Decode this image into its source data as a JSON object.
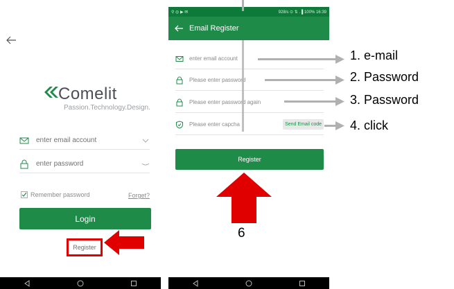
{
  "login_screen": {
    "brand": "Comelit",
    "tagline": "Passion.Technology.Design.",
    "email_placeholder": "enter email account",
    "password_placeholder": "enter password",
    "remember_label": "Remember password",
    "forget_label": "Forget?",
    "login_label": "Login",
    "register_label": "Register"
  },
  "register_screen": {
    "status_text": "928/s ⊙ ⇅ .▐ 100% 16:39",
    "title": "Email Register",
    "email_placeholder": "enter email account",
    "password_placeholder": "Please enter password",
    "password_again_placeholder": "Please enter password again",
    "captcha_placeholder": "Please enter capcha",
    "send_code_label": "Send Email code",
    "register_label": "Register"
  },
  "annotations": {
    "step1": "1. e-mail",
    "step2": "2. Password",
    "step3": "3. Password",
    "step4": "4. click",
    "step6": "6"
  },
  "colors": {
    "primary_green": "#1e8c48",
    "arrow_red": "#e00000",
    "pointer_gray": "#b0b0b0"
  },
  "icons": [
    "back-arrow-icon",
    "comelit-logo-icon",
    "envelope-icon",
    "lock-icon",
    "chevron-down-icon",
    "eye-closed-icon",
    "checkbox-icon",
    "shield-icon",
    "nav-back-icon",
    "nav-home-icon",
    "nav-recents-icon"
  ]
}
